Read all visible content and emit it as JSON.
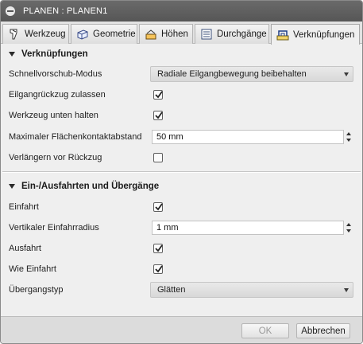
{
  "window": {
    "title": "PLANEN : PLANEN1"
  },
  "tabs": [
    {
      "label": "Werkzeug",
      "icon": "tool-icon"
    },
    {
      "label": "Geometrie",
      "icon": "geometry-icon"
    },
    {
      "label": "Höhen",
      "icon": "heights-icon"
    },
    {
      "label": "Durchgänge",
      "icon": "passes-icon"
    },
    {
      "label": "Verknüpfungen",
      "icon": "linking-icon",
      "active": true
    }
  ],
  "linking": {
    "header": "Verknüpfungen",
    "rapid_mode_label": "Schnellvorschub-Modus",
    "rapid_mode_value": "Radiale Eilgangbewegung beibehalten",
    "allow_retract_label": "Eilgangrückzug zulassen",
    "allow_retract_checked": true,
    "keep_tool_down_label": "Werkzeug unten halten",
    "keep_tool_down_checked": true,
    "max_stay_down_label": "Maximaler Flächenkontaktabstand",
    "max_stay_down_value": "50 mm",
    "extend_before_retract_label": "Verlängern vor Rückzug",
    "extend_before_retract_checked": false
  },
  "leads": {
    "header": "Ein-/Ausfahrten und Übergänge",
    "entry_label": "Einfahrt",
    "entry_checked": true,
    "vertical_entry_radius_label": "Vertikaler Einfahrradius",
    "vertical_entry_radius_value": "1 mm",
    "exit_label": "Ausfahrt",
    "exit_checked": true,
    "same_as_entry_label": "Wie Einfahrt",
    "same_as_entry_checked": true,
    "transition_type_label": "Übergangstyp",
    "transition_type_value": "Glätten"
  },
  "footer": {
    "ok_label": "OK",
    "cancel_label": "Abbrechen"
  },
  "colors": {
    "titlebar": "#5f5f5f",
    "panel": "#efefef",
    "footer": "#dcdcdc"
  }
}
